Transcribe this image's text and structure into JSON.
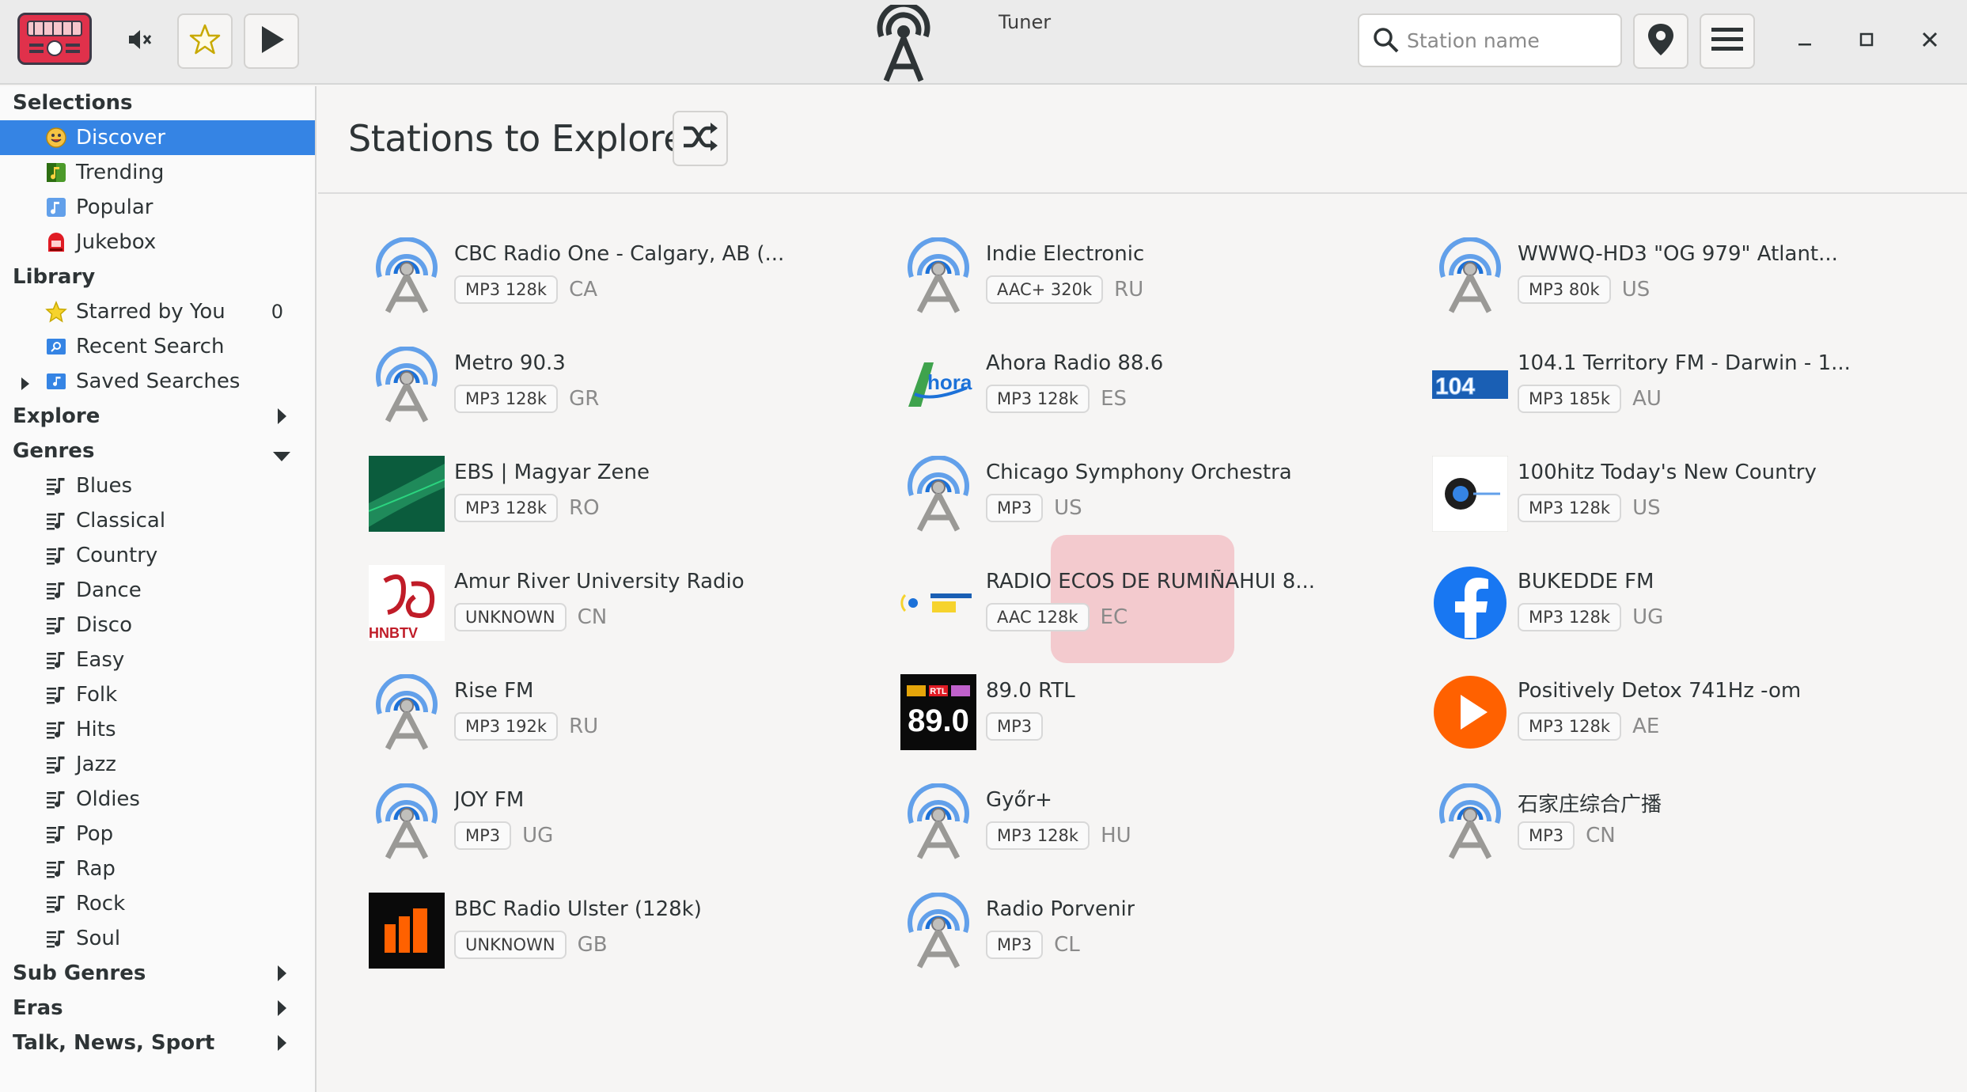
{
  "app": {
    "title": "Tuner"
  },
  "search": {
    "placeholder": "Station name"
  },
  "sidebar": {
    "selections": {
      "label": "Selections",
      "items": [
        {
          "label": "Discover"
        },
        {
          "label": "Trending"
        },
        {
          "label": "Popular"
        },
        {
          "label": "Jukebox"
        }
      ]
    },
    "library": {
      "label": "Library",
      "items": [
        {
          "label": "Starred by You",
          "count": "0"
        },
        {
          "label": "Recent Search"
        },
        {
          "label": "Saved Searches"
        }
      ]
    },
    "explore": {
      "label": "Explore"
    },
    "genres": {
      "label": "Genres",
      "items": [
        {
          "label": "Blues"
        },
        {
          "label": "Classical"
        },
        {
          "label": "Country"
        },
        {
          "label": "Dance"
        },
        {
          "label": "Disco"
        },
        {
          "label": "Easy"
        },
        {
          "label": "Folk"
        },
        {
          "label": "Hits"
        },
        {
          "label": "Jazz"
        },
        {
          "label": "Oldies"
        },
        {
          "label": "Pop"
        },
        {
          "label": "Rap"
        },
        {
          "label": "Rock"
        },
        {
          "label": "Soul"
        }
      ]
    },
    "sub_genres": {
      "label": "Sub Genres"
    },
    "eras": {
      "label": "Eras"
    },
    "talk": {
      "label": "Talk, News, Sport"
    }
  },
  "main": {
    "title": "Stations to Explore",
    "stations": [
      {
        "name": "CBC Radio One - Calgary, AB (...",
        "codec": "MP3 128k",
        "country": "CA"
      },
      {
        "name": "Indie Electronic",
        "codec": "AAC+ 320k",
        "country": "RU"
      },
      {
        "name": "WWWQ-HD3 \"OG 979\" Atlant...",
        "codec": "MP3 80k",
        "country": "US"
      },
      {
        "name": "Metro 90.3",
        "codec": "MP3 128k",
        "country": "GR"
      },
      {
        "name": "Ahora Radio 88.6",
        "codec": "MP3 128k",
        "country": "ES"
      },
      {
        "name": "104.1 Territory FM - Darwin - 1...",
        "codec": "MP3 185k",
        "country": "AU"
      },
      {
        "name": "EBS | Magyar Zene",
        "codec": "MP3 128k",
        "country": "RO"
      },
      {
        "name": "Chicago Symphony Orchestra",
        "codec": "MP3",
        "country": "US"
      },
      {
        "name": "100hitz Today's New Country",
        "codec": "MP3 128k",
        "country": "US"
      },
      {
        "name": "Amur River University Radio",
        "codec": "UNKNOWN",
        "country": "CN"
      },
      {
        "name": "RADIO ECOS DE RUMIÑAHUI 8...",
        "codec": "AAC 128k",
        "country": "EC"
      },
      {
        "name": "BUKEDDE FM",
        "codec": "MP3 128k",
        "country": "UG"
      },
      {
        "name": "Rise FM",
        "codec": "MP3 192k",
        "country": "RU"
      },
      {
        "name": "89.0 RTL",
        "codec": "MP3",
        "country": ""
      },
      {
        "name": "Positively Detox 741Hz -om",
        "codec": "MP3 128k",
        "country": "AE"
      },
      {
        "name": "JOY FM",
        "codec": "MP3",
        "country": "UG"
      },
      {
        "name": "Győr+",
        "codec": "MP3 128k",
        "country": "HU"
      },
      {
        "name": "石家庄综合广播",
        "codec": "MP3",
        "country": "CN"
      },
      {
        "name": "BBC Radio Ulster (128k)",
        "codec": "UNKNOWN",
        "country": "GB"
      },
      {
        "name": "Radio Porvenir",
        "codec": "MP3",
        "country": "CL"
      }
    ],
    "logos": {
      "hnb": "HNBTV",
      "ahora": "hora",
      "rtl_small": "RTL",
      "rtl_big": "89.0",
      "territory": "104"
    }
  },
  "colors": {
    "accent": "#3584e4",
    "radio": "#e0314b"
  }
}
